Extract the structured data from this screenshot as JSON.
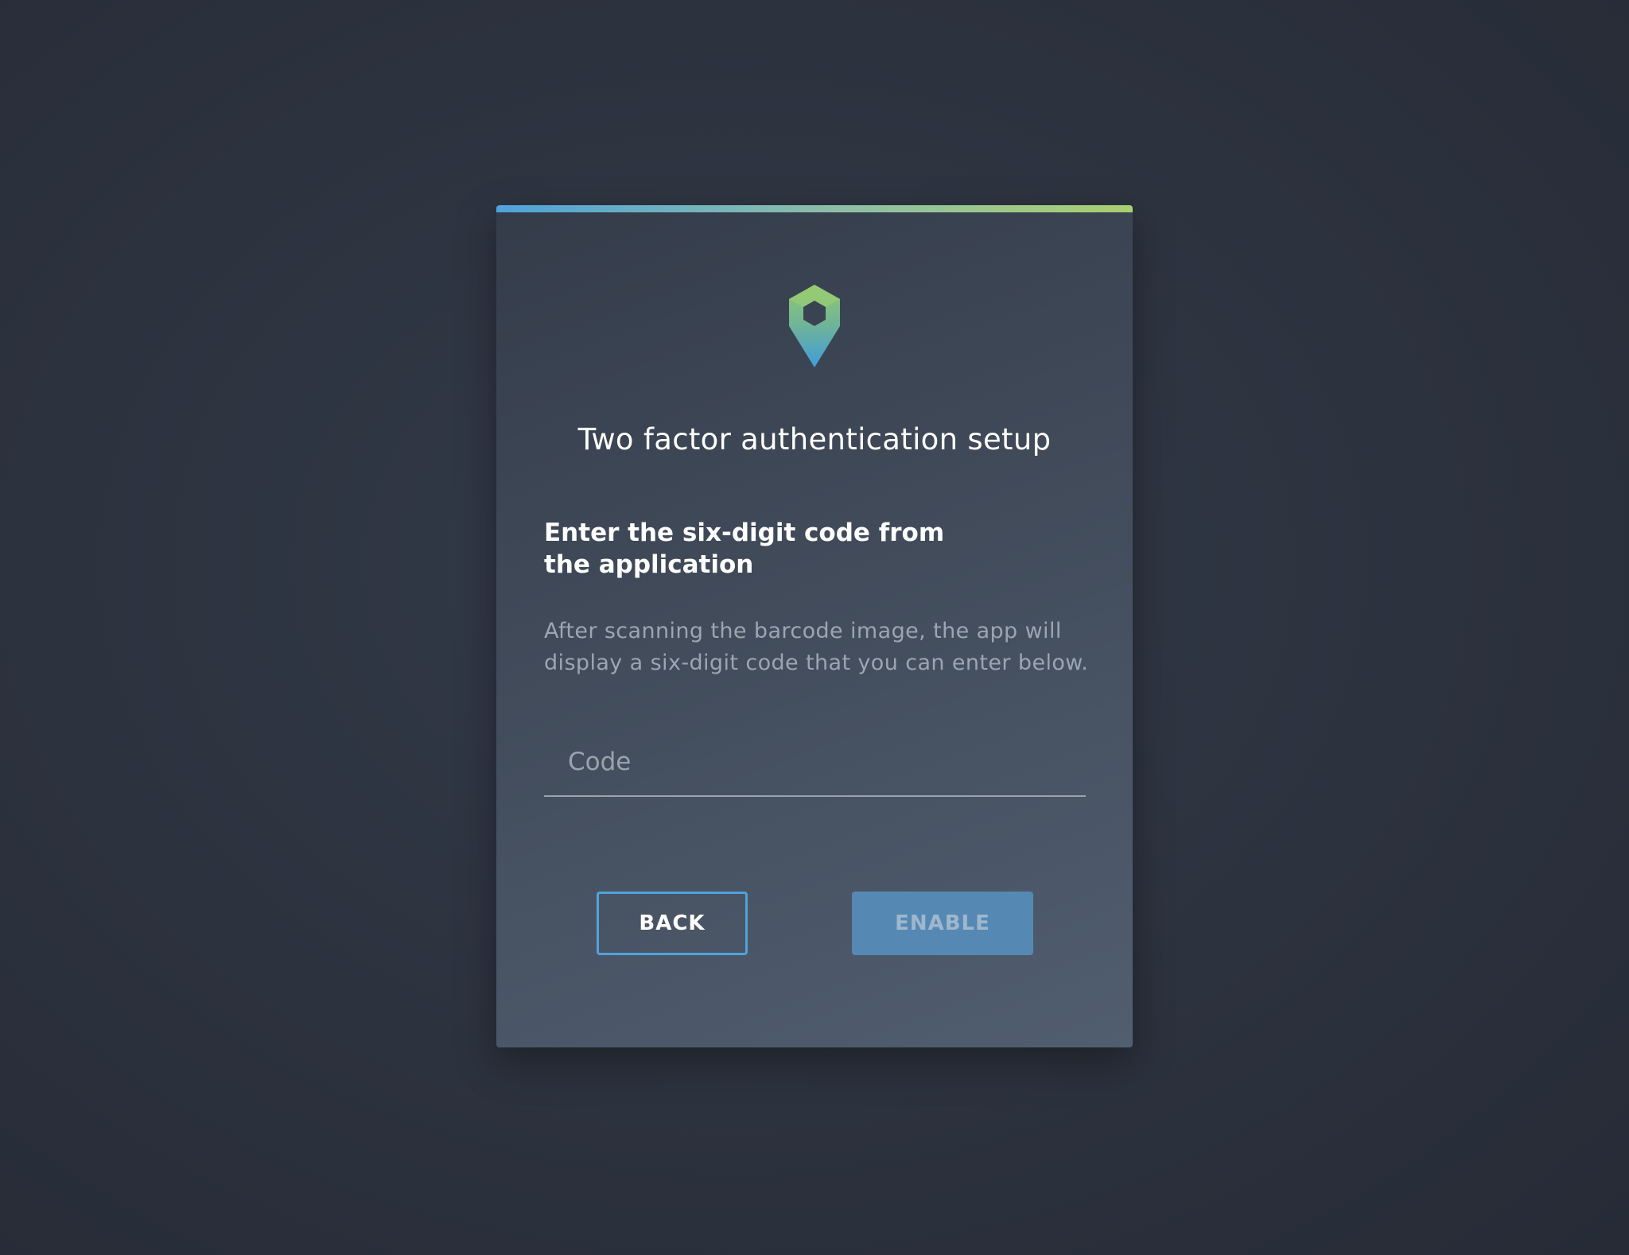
{
  "card": {
    "title": "Two factor authentication setup",
    "subtitle": "Enter the six-digit code from the application",
    "description": "After scanning the barcode image, the app will display a six-digit code that you can enter below.",
    "code_input": {
      "placeholder": "Code",
      "value": ""
    },
    "buttons": {
      "back_label": "BACK",
      "enable_label": "ENABLE",
      "enable_disabled": true
    }
  },
  "icons": {
    "logo": "hexagon-pin-logo-icon"
  },
  "colors": {
    "background": "#2c323e",
    "card": "#434d5c",
    "accent_start": "#4fa3d9",
    "accent_end": "#a9cf6f",
    "primary_button": "#5589b3",
    "outline_button_border": "#4fa3dd"
  }
}
